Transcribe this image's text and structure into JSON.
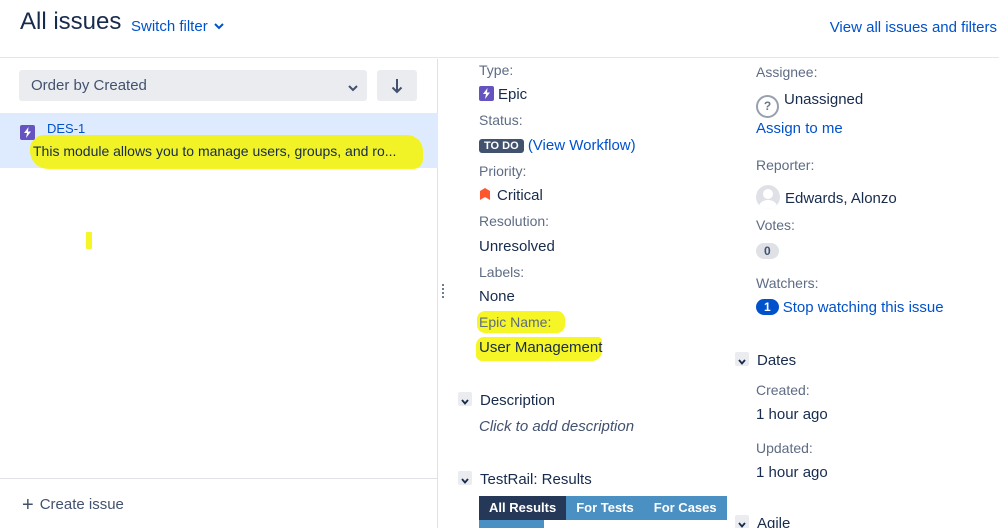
{
  "header": {
    "title": "All issues",
    "switch_filter": "Switch filter",
    "view_all": "View all issues and filters"
  },
  "list": {
    "order_select": "Order by Created",
    "sort_icon": "arrow-down-icon",
    "issues": [
      {
        "key": "DES-1",
        "type_icon": "epic-icon",
        "summary": "This module allows you to manage users, groups, and ro..."
      }
    ],
    "create_issue": "Create issue"
  },
  "details": {
    "type_label": "Type:",
    "type_value": "Epic",
    "status_label": "Status:",
    "status_value": "TO DO",
    "view_workflow": "(View Workflow)",
    "priority_label": "Priority:",
    "priority_value": "Critical",
    "resolution_label": "Resolution:",
    "resolution_value": "Unresolved",
    "labels_label": "Labels:",
    "labels_value": "None",
    "epic_name_label": "Epic Name:",
    "epic_name_value": "User Management",
    "description_heading": "Description",
    "description_placeholder": "Click to add description",
    "testrail_heading": "TestRail: Results",
    "testrail_tabs": [
      "All Results",
      "For Tests",
      "For Cases"
    ]
  },
  "people": {
    "assignee_label": "Assignee:",
    "assignee_value": "Unassigned",
    "assign_to_me": "Assign to me",
    "reporter_label": "Reporter:",
    "reporter_value": "Edwards, Alonzo",
    "votes_label": "Votes:",
    "votes_value": "0",
    "watchers_label": "Watchers:",
    "watchers_count": "1",
    "stop_watching": "Stop watching this issue"
  },
  "dates": {
    "heading": "Dates",
    "created_label": "Created:",
    "created_value": "1 hour ago",
    "updated_label": "Updated:",
    "updated_value": "1 hour ago"
  },
  "agile": {
    "heading": "Agile"
  },
  "colors": {
    "link": "#0052cc",
    "epic": "#6554c0",
    "highlight": "#f5f500",
    "selected_row": "#deebff"
  }
}
